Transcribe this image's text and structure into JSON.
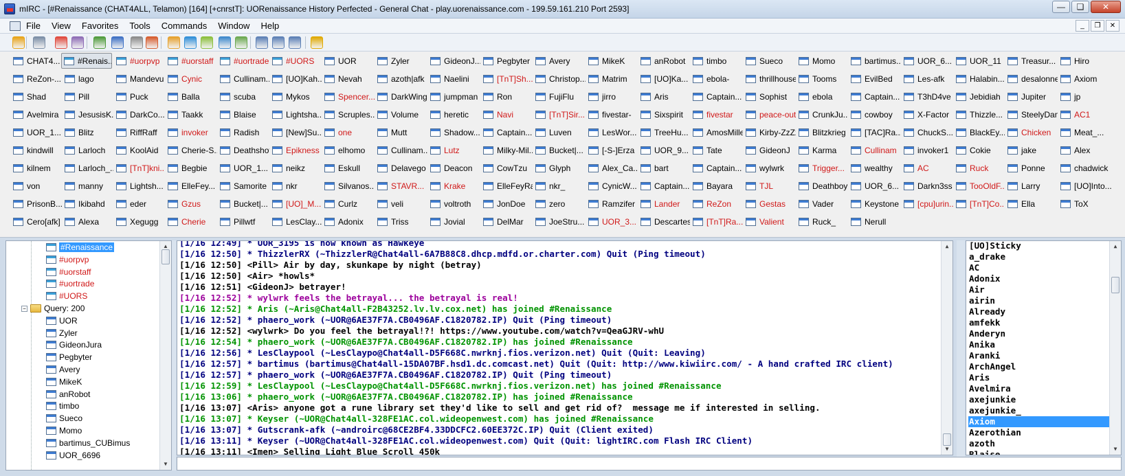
{
  "window": {
    "title": "mIRC - [#Renaissance (CHAT4ALL, Telamon) [164] [+cnrstT]: UORenaissance History Perfected - General Chat - play.uorenaissance.com - 199.59.161.210 Port 2593]",
    "minimize": "—",
    "restore": "❏",
    "close": "✕"
  },
  "menu": [
    "File",
    "View",
    "Favorites",
    "Tools",
    "Commands",
    "Window",
    "Help"
  ],
  "mdi": {
    "minimize": "_",
    "restore": "❐",
    "close": "✕"
  },
  "toolbar_icons": [
    "connect-icon",
    "options-icon",
    "favorites-icon",
    "address-book-icon",
    "script-editor-icon",
    "channel-list-icon",
    "timer-icon",
    "colors-icon",
    "send-file-icon",
    "get-file-icon",
    "dcc-chat-icon",
    "notify-list-icon",
    "url-list-icon",
    "tile-horizontal-icon",
    "tile-vertical-icon",
    "cascade-icon",
    "help-icon"
  ],
  "switchbar": {
    "rows": [
      [
        {
          "t": "CHAT4...",
          "c": "black",
          "k": "status"
        },
        {
          "t": "#Renais...",
          "c": "black",
          "k": "chan",
          "a": true
        },
        {
          "t": "#uorpvp",
          "c": "red",
          "k": "chan"
        },
        {
          "t": "#uorstaff",
          "c": "red",
          "k": "chan"
        },
        {
          "t": "#uortrade",
          "c": "red",
          "k": "chan"
        },
        {
          "t": "#UORS",
          "c": "red",
          "k": "chan"
        },
        {
          "t": "UOR",
          "c": "black"
        },
        {
          "t": "Zyler",
          "c": "black"
        },
        {
          "t": "GideonJ...",
          "c": "black"
        },
        {
          "t": "Pegbyter",
          "c": "black"
        },
        {
          "t": "Avery",
          "c": "black"
        },
        {
          "t": "MikeK",
          "c": "black"
        },
        {
          "t": "anRobot",
          "c": "black"
        },
        {
          "t": "timbo",
          "c": "black"
        },
        {
          "t": "Sueco",
          "c": "black"
        },
        {
          "t": "Momo",
          "c": "black"
        },
        {
          "t": "bartimus...",
          "c": "black"
        },
        {
          "t": "UOR_6...",
          "c": "black"
        },
        {
          "t": "UOR_11",
          "c": "black"
        },
        {
          "t": "Treasur...",
          "c": "black"
        },
        {
          "t": "Hiro",
          "c": "black"
        }
      ],
      [
        {
          "t": "ReZon-...",
          "c": "black"
        },
        {
          "t": "lago",
          "c": "black"
        },
        {
          "t": "Mandevu",
          "c": "black"
        },
        {
          "t": "Cynic",
          "c": "red"
        },
        {
          "t": "Cullinam...",
          "c": "black"
        },
        {
          "t": "[UO]Kah...",
          "c": "black"
        },
        {
          "t": "Nevah",
          "c": "black"
        },
        {
          "t": "azoth|afk",
          "c": "black"
        },
        {
          "t": "Naelini",
          "c": "black"
        },
        {
          "t": "[TnT]Sh...",
          "c": "red"
        },
        {
          "t": "Christop...",
          "c": "black"
        },
        {
          "t": "Matrim",
          "c": "black"
        },
        {
          "t": "[UO]Ka...",
          "c": "black"
        },
        {
          "t": "ebola-",
          "c": "black"
        },
        {
          "t": "thrillhouse",
          "c": "black"
        },
        {
          "t": "Tooms",
          "c": "black"
        },
        {
          "t": "EvilBed",
          "c": "black"
        },
        {
          "t": "Les-afk",
          "c": "black"
        },
        {
          "t": "Halabin...",
          "c": "black"
        },
        {
          "t": "desalonne",
          "c": "black"
        },
        {
          "t": "Axiom",
          "c": "black"
        }
      ],
      [
        {
          "t": "Shad",
          "c": "black"
        },
        {
          "t": "Pill",
          "c": "black"
        },
        {
          "t": "Puck",
          "c": "black"
        },
        {
          "t": "Balla",
          "c": "black"
        },
        {
          "t": "scuba",
          "c": "black"
        },
        {
          "t": "Mykos",
          "c": "black"
        },
        {
          "t": "Spencer...",
          "c": "red"
        },
        {
          "t": "DarkWing",
          "c": "black"
        },
        {
          "t": "jumpman",
          "c": "black"
        },
        {
          "t": "Ron",
          "c": "black"
        },
        {
          "t": "FujiFlu",
          "c": "black"
        },
        {
          "t": "jirro",
          "c": "black"
        },
        {
          "t": "Aris",
          "c": "black"
        },
        {
          "t": "Captain...",
          "c": "black"
        },
        {
          "t": "Sophist",
          "c": "black"
        },
        {
          "t": "ebola",
          "c": "black"
        },
        {
          "t": "Captain...",
          "c": "black"
        },
        {
          "t": "T3hD4ve",
          "c": "black"
        },
        {
          "t": "Jebidiah",
          "c": "black"
        },
        {
          "t": "Jupiter",
          "c": "black"
        },
        {
          "t": "jp",
          "c": "black"
        }
      ],
      [
        {
          "t": "Avelmira",
          "c": "black"
        },
        {
          "t": "JesusisK...",
          "c": "black"
        },
        {
          "t": "DarkCo...",
          "c": "black"
        },
        {
          "t": "Taakk",
          "c": "black"
        },
        {
          "t": "Blaise",
          "c": "black"
        },
        {
          "t": "Lightsha...",
          "c": "black"
        },
        {
          "t": "Scruples...",
          "c": "black"
        },
        {
          "t": "Volume",
          "c": "black"
        },
        {
          "t": "heretic",
          "c": "black"
        },
        {
          "t": "Navi",
          "c": "red"
        },
        {
          "t": "[TnT]Sir...",
          "c": "red"
        },
        {
          "t": "fivestar-",
          "c": "black"
        },
        {
          "t": "Sixspirit",
          "c": "black"
        },
        {
          "t": "fivestar",
          "c": "red"
        },
        {
          "t": "peace-out",
          "c": "red"
        },
        {
          "t": "CrunkJu...",
          "c": "black"
        },
        {
          "t": "cowboy",
          "c": "black"
        },
        {
          "t": "X-Factor",
          "c": "black"
        },
        {
          "t": "Thizzle...",
          "c": "black"
        },
        {
          "t": "SteelyDan",
          "c": "black"
        },
        {
          "t": "AC1",
          "c": "red"
        }
      ],
      [
        {
          "t": "UOR_1...",
          "c": "black"
        },
        {
          "t": "Blitz",
          "c": "black"
        },
        {
          "t": "RiffRaff",
          "c": "black"
        },
        {
          "t": "invoker",
          "c": "red"
        },
        {
          "t": "Radish",
          "c": "black"
        },
        {
          "t": "[New]Su...",
          "c": "black"
        },
        {
          "t": "one",
          "c": "red"
        },
        {
          "t": "Mutt",
          "c": "black"
        },
        {
          "t": "Shadow...",
          "c": "black"
        },
        {
          "t": "Captain...",
          "c": "black"
        },
        {
          "t": "Luven",
          "c": "black"
        },
        {
          "t": "LesWor...",
          "c": "black"
        },
        {
          "t": "TreeHu...",
          "c": "black"
        },
        {
          "t": "AmosMiller",
          "c": "black"
        },
        {
          "t": "Kirby-ZzZz",
          "c": "black"
        },
        {
          "t": "Blitzkrieg",
          "c": "black"
        },
        {
          "t": "[TAC]Ra...",
          "c": "black"
        },
        {
          "t": "ChuckS...",
          "c": "black"
        },
        {
          "t": "BlackEy...",
          "c": "black"
        },
        {
          "t": "Chicken",
          "c": "red"
        },
        {
          "t": "Meat_...",
          "c": "black"
        }
      ],
      [
        {
          "t": "kindwill",
          "c": "black"
        },
        {
          "t": "Larloch",
          "c": "black"
        },
        {
          "t": "KoolAid",
          "c": "black"
        },
        {
          "t": "Cherie-S...",
          "c": "black"
        },
        {
          "t": "Deathshot",
          "c": "black"
        },
        {
          "t": "Epikness",
          "c": "red"
        },
        {
          "t": "elhomo",
          "c": "black"
        },
        {
          "t": "Cullinam...",
          "c": "black"
        },
        {
          "t": "Lutz",
          "c": "red"
        },
        {
          "t": "Milky-Mil...",
          "c": "black"
        },
        {
          "t": "Bucket|...",
          "c": "black"
        },
        {
          "t": "[-S-]Erza",
          "c": "black"
        },
        {
          "t": "UOR_9...",
          "c": "black"
        },
        {
          "t": "Tate",
          "c": "black"
        },
        {
          "t": "GideonJ",
          "c": "black"
        },
        {
          "t": "Karma",
          "c": "black"
        },
        {
          "t": "Cullinam",
          "c": "red"
        },
        {
          "t": "invoker1",
          "c": "black"
        },
        {
          "t": "Cokie",
          "c": "black"
        },
        {
          "t": "jake",
          "c": "black"
        },
        {
          "t": "Alex",
          "c": "black"
        }
      ],
      [
        {
          "t": "kilnem",
          "c": "black"
        },
        {
          "t": "Larloch_...",
          "c": "black"
        },
        {
          "t": "[TnT]kni...",
          "c": "red"
        },
        {
          "t": "Begbie",
          "c": "black"
        },
        {
          "t": "UOR_1...",
          "c": "black"
        },
        {
          "t": "neikz",
          "c": "black"
        },
        {
          "t": "Eskull",
          "c": "black"
        },
        {
          "t": "Delavego",
          "c": "black"
        },
        {
          "t": "Deacon",
          "c": "black"
        },
        {
          "t": "CowTzu",
          "c": "black"
        },
        {
          "t": "Glyph",
          "c": "black"
        },
        {
          "t": "Alex_Ca...",
          "c": "black"
        },
        {
          "t": "bart",
          "c": "black"
        },
        {
          "t": "Captain...",
          "c": "black"
        },
        {
          "t": "wylwrk",
          "c": "black"
        },
        {
          "t": "Trigger...",
          "c": "red"
        },
        {
          "t": "wealthy",
          "c": "black"
        },
        {
          "t": "AC",
          "c": "red"
        },
        {
          "t": "Ruck",
          "c": "red"
        },
        {
          "t": "Ponne",
          "c": "black"
        },
        {
          "t": "chadwick",
          "c": "black"
        }
      ],
      [
        {
          "t": "von",
          "c": "black"
        },
        {
          "t": "manny",
          "c": "black"
        },
        {
          "t": "Lightsh...",
          "c": "black"
        },
        {
          "t": "ElleFey...",
          "c": "black"
        },
        {
          "t": "Samorite",
          "c": "black"
        },
        {
          "t": "nkr",
          "c": "black"
        },
        {
          "t": "Silvanos...",
          "c": "black"
        },
        {
          "t": "STAVR...",
          "c": "red"
        },
        {
          "t": "Krake",
          "c": "red"
        },
        {
          "t": "ElleFeyRa",
          "c": "black"
        },
        {
          "t": "nkr_",
          "c": "black"
        },
        {
          "t": "CynicW...",
          "c": "black"
        },
        {
          "t": "Captain...",
          "c": "black"
        },
        {
          "t": "Bayara",
          "c": "black"
        },
        {
          "t": "TJL",
          "c": "red"
        },
        {
          "t": "Deathboy",
          "c": "black"
        },
        {
          "t": "UOR_6...",
          "c": "black"
        },
        {
          "t": "Darkn3ss",
          "c": "black"
        },
        {
          "t": "TooOldF...",
          "c": "red"
        },
        {
          "t": "Larry",
          "c": "black"
        },
        {
          "t": "[UO]Into...",
          "c": "black"
        }
      ],
      [
        {
          "t": "PrisonB...",
          "c": "black"
        },
        {
          "t": "Ikibahd",
          "c": "black"
        },
        {
          "t": "eder",
          "c": "black"
        },
        {
          "t": "Gzus",
          "c": "red"
        },
        {
          "t": "Bucket|...",
          "c": "black"
        },
        {
          "t": "[UO]_M...",
          "c": "red"
        },
        {
          "t": "Curlz",
          "c": "black"
        },
        {
          "t": "veli",
          "c": "black"
        },
        {
          "t": "voltroth",
          "c": "black"
        },
        {
          "t": "JonDoe",
          "c": "black"
        },
        {
          "t": "zero",
          "c": "black"
        },
        {
          "t": "Ramzifer",
          "c": "black"
        },
        {
          "t": "Lander",
          "c": "red"
        },
        {
          "t": "ReZon",
          "c": "red"
        },
        {
          "t": "Gestas",
          "c": "red"
        },
        {
          "t": "Vader",
          "c": "black"
        },
        {
          "t": "Keystone",
          "c": "black"
        },
        {
          "t": "[cpu]urin...",
          "c": "red"
        },
        {
          "t": "[TnT]Co...",
          "c": "red"
        },
        {
          "t": "Ella",
          "c": "black"
        },
        {
          "t": "ToX",
          "c": "black"
        }
      ],
      [
        {
          "t": "Cero[afk]",
          "c": "black"
        },
        {
          "t": "Alexa",
          "c": "black"
        },
        {
          "t": "Xegugg",
          "c": "black"
        },
        {
          "t": "Cherie",
          "c": "red"
        },
        {
          "t": "Pillwtf",
          "c": "black"
        },
        {
          "t": "LesClay...",
          "c": "black"
        },
        {
          "t": "Adonix",
          "c": "black"
        },
        {
          "t": "Triss",
          "c": "black"
        },
        {
          "t": "Jovial",
          "c": "black"
        },
        {
          "t": "DelMar",
          "c": "black"
        },
        {
          "t": "JoeStru...",
          "c": "black"
        },
        {
          "t": "UOR_3...",
          "c": "red"
        },
        {
          "t": "Descartes",
          "c": "black"
        },
        {
          "t": "[TnT]Ra...",
          "c": "red"
        },
        {
          "t": "Valient",
          "c": "red"
        },
        {
          "t": "Ruck_",
          "c": "black"
        },
        {
          "t": "Nerull",
          "c": "black"
        }
      ]
    ]
  },
  "tree": {
    "channels": [
      {
        "t": "#Renaissance",
        "c": "black",
        "sel": true
      },
      {
        "t": "#uorpvp",
        "c": "red"
      },
      {
        "t": "#uorstaff",
        "c": "red"
      },
      {
        "t": "#uortrade",
        "c": "red"
      },
      {
        "t": "#UORS",
        "c": "red"
      }
    ],
    "query_folder": "Query: 200",
    "expander": "−",
    "queries": [
      "UOR",
      "Zyler",
      "GideonJura",
      "Pegbyter",
      "Avery",
      "MikeK",
      "anRobot",
      "timbo",
      "Sueco",
      "Momo",
      "bartimus_CUBimus",
      "UOR_6696"
    ]
  },
  "chat": [
    {
      "t": "[1/16 12:49] * UOR_3195 is now known as Hawkeye",
      "c": "navy"
    },
    {
      "t": "[1/16 12:50] * ThizzlerRX (~ThizzlerR@Chat4all-6A7B88C8.dhcp.mdfd.or.charter.com) Quit (Ping timeout)",
      "c": "navy"
    },
    {
      "t": "[1/16 12:50] <Pill> Air by day, skunkape by night (betray)",
      "c": "black"
    },
    {
      "t": "[1/16 12:50] <Air> *howls*",
      "c": "black"
    },
    {
      "t": "[1/16 12:51] <GideonJ> betrayer!",
      "c": "black"
    },
    {
      "t": "[1/16 12:52] * wylwrk feels the betrayal... the betrayal is real!",
      "c": "purple"
    },
    {
      "t": "[1/16 12:52] * Aris (~Aris@Chat4all-F2B43252.lv.lv.cox.net) has joined #Renaissance",
      "c": "green"
    },
    {
      "t": "[1/16 12:52] * phaero_work (~UOR@6AE37F7A.CB0496AF.C1820782.IP) Quit (Ping timeout)",
      "c": "navy"
    },
    {
      "t": "[1/16 12:52] <wylwrk> Do you feel the betrayal!?! https://www.youtube.com/watch?v=QeaGJRV-whU",
      "c": "black"
    },
    {
      "t": "[1/16 12:54] * phaero_work (~UOR@6AE37F7A.CB0496AF.C1820782.IP) has joined #Renaissance",
      "c": "green"
    },
    {
      "t": "[1/16 12:56] * LesClaypool (~LesClaypo@Chat4all-D5F668C.nwrknj.fios.verizon.net) Quit (Quit: Leaving)",
      "c": "navy"
    },
    {
      "t": "[1/16 12:57] * bartimus (bartimus@Chat4all-15DA07BF.hsd1.dc.comcast.net) Quit (Quit: http://www.kiwiirc.com/ - A hand crafted IRC client)",
      "c": "navy"
    },
    {
      "t": "[1/16 12:57] * phaero_work (~UOR@6AE37F7A.CB0496AF.C1820782.IP) Quit (Ping timeout)",
      "c": "navy"
    },
    {
      "t": "[1/16 12:59] * LesClaypool (~LesClaypo@Chat4all-D5F668C.nwrknj.fios.verizon.net) has joined #Renaissance",
      "c": "green"
    },
    {
      "t": "[1/16 13:06] * phaero_work (~UOR@6AE37F7A.CB0496AF.C1820782.IP) has joined #Renaissance",
      "c": "green"
    },
    {
      "t": "[1/16 13:07] <Aris> anyone got a rune library set they'd like to sell and get rid of?  message me if interested in selling.",
      "c": "black"
    },
    {
      "t": "[1/16 13:07] * Keyser (~UOR@Chat4all-328FE1AC.col.wideopenwest.com) has joined #Renaissance",
      "c": "green"
    },
    {
      "t": "[1/16 13:07] * Gutscrank-afk (~androirc@68CE2BF4.33DDCFC2.60EE372C.IP) Quit (Client exited)",
      "c": "navy"
    },
    {
      "t": "[1/16 13:11] * Keyser (~UOR@Chat4all-328FE1AC.col.wideopenwest.com) Quit (Quit: lightIRC.com Flash IRC Client)",
      "c": "navy"
    },
    {
      "t": "[1/16 13:11] <Imen> Selling Light Blue Scroll 450k",
      "c": "black"
    }
  ],
  "nicklist": {
    "nicks": [
      "[UO]Sticky",
      "a_drake",
      "AC",
      "Adonix",
      "Air",
      "airin",
      "Already",
      "amfekk",
      "Anderyn",
      "Anika",
      "Aranki",
      "ArchAngel",
      "Aris",
      "Avelmira",
      "axejunkie",
      "axejunkie_",
      "Axiom",
      "Azerothian",
      "azoth",
      "Blaise"
    ],
    "selected": "Axiom"
  },
  "editbox": {
    "value": ""
  },
  "scroll": {
    "up": "▲",
    "down": "▼"
  },
  "colors": {
    "red": "#d01818",
    "navy": "#00007f",
    "green": "#009300",
    "purple": "#9c009c",
    "selection": "#3399ff"
  }
}
